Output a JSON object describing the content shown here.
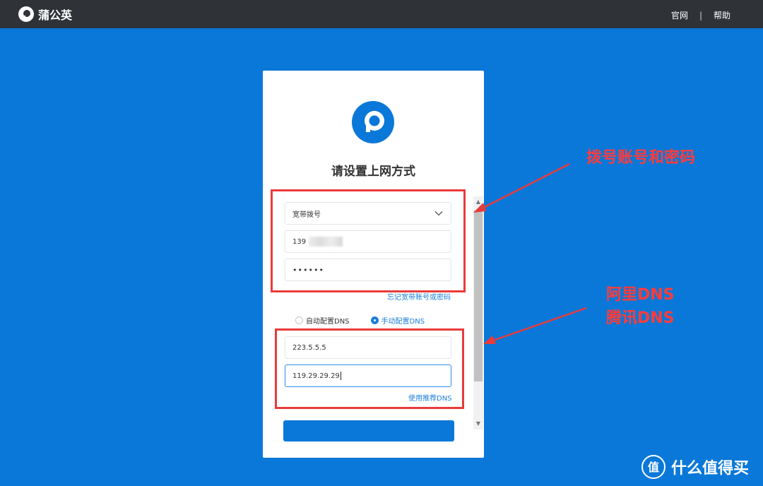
{
  "header": {
    "brand_name": "蒲公英",
    "links": [
      "官网",
      "帮助"
    ],
    "separator": "|"
  },
  "card": {
    "title": "请设置上网方式",
    "connection_type": "宽带拨号",
    "account_value": "139",
    "password_mask": "••••••",
    "forgot_link": "忘记宽带账号或密码",
    "dns_options": [
      {
        "label": "自动配置DNS",
        "selected": false
      },
      {
        "label": "手动配置DNS",
        "selected": true
      }
    ],
    "dns_primary": "223.5.5.5",
    "dns_secondary": "119.29.29.29",
    "recommended_dns_link": "使用推荐DNS"
  },
  "annotations": {
    "account_note": "拨号账号和密码",
    "dns_note_line1": "阿里DNS",
    "dns_note_line2": "腾讯DNS"
  },
  "watermark": {
    "badge": "值",
    "text": "什么值得买"
  },
  "colors": {
    "background": "#0a78d8",
    "topbar": "#2f3338",
    "accent": "#1a7fdc",
    "annotation": "#ea3a3a"
  }
}
